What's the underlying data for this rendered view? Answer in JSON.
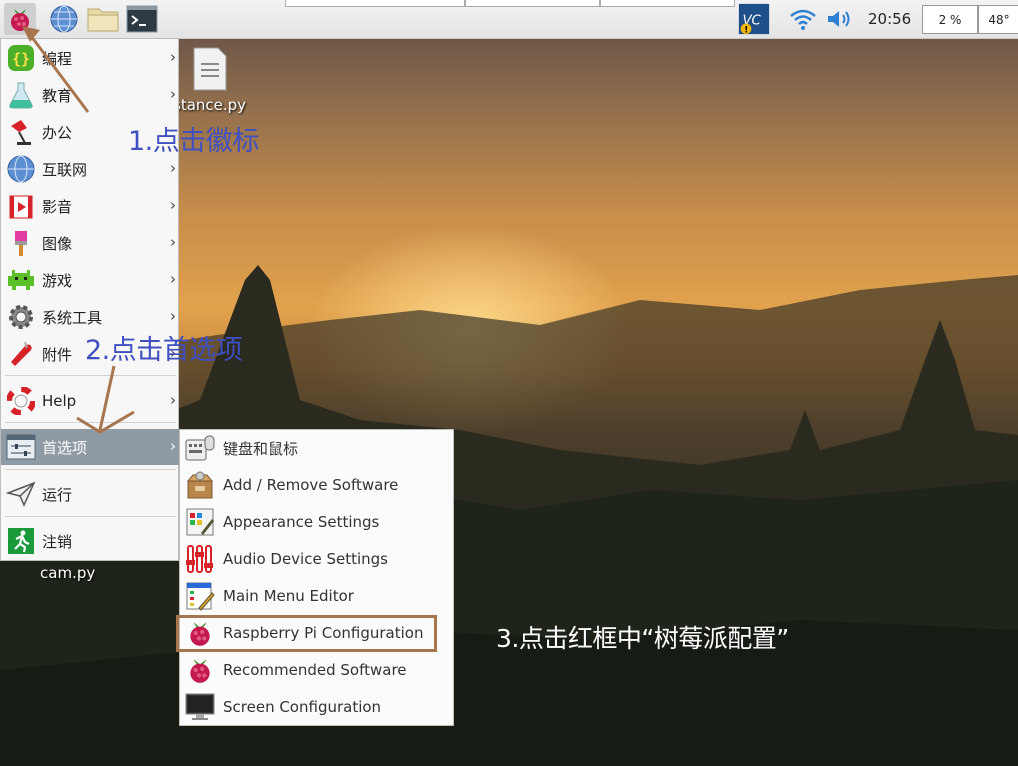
{
  "taskbar": {
    "icons": [
      "raspberry-icon",
      "globe-icon",
      "folder-icon",
      "terminal-icon",
      "vnc-icon",
      "wifi-icon",
      "volume-icon"
    ],
    "clock": "20:56",
    "cpu": "2 %",
    "temp": "48°"
  },
  "desktop": {
    "files": [
      {
        "label": "stance.py"
      },
      {
        "label": "cam.py"
      }
    ]
  },
  "menu": {
    "items": [
      {
        "label": "编程",
        "icon": "programming-icon",
        "submenu": true
      },
      {
        "label": "教育",
        "icon": "education-icon",
        "submenu": true
      },
      {
        "label": "办公",
        "icon": "office-icon",
        "submenu": true
      },
      {
        "label": "互联网",
        "icon": "internet-icon",
        "submenu": true
      },
      {
        "label": "影音",
        "icon": "media-icon",
        "submenu": true
      },
      {
        "label": "图像",
        "icon": "graphics-icon",
        "submenu": true
      },
      {
        "label": "游戏",
        "icon": "games-icon",
        "submenu": true
      },
      {
        "label": "系统工具",
        "icon": "system-tools-icon",
        "submenu": true
      },
      {
        "label": "附件",
        "icon": "accessories-icon",
        "submenu": true
      },
      {
        "label": "Help",
        "icon": "help-icon",
        "submenu": true
      },
      {
        "label": "首选项",
        "icon": "preferences-icon",
        "submenu": true,
        "selected": true
      },
      {
        "label": "运行",
        "icon": "run-icon",
        "submenu": false
      },
      {
        "label": "注销",
        "icon": "logout-icon",
        "submenu": false
      }
    ],
    "arrow": "›"
  },
  "submenu": {
    "items": [
      {
        "label": "键盘和鼠标",
        "icon": "keyboard-mouse-icon"
      },
      {
        "label": "Add / Remove Software",
        "icon": "package-icon"
      },
      {
        "label": "Appearance Settings",
        "icon": "appearance-icon"
      },
      {
        "label": "Audio Device Settings",
        "icon": "audio-mixer-icon"
      },
      {
        "label": "Main Menu Editor",
        "icon": "menu-editor-icon"
      },
      {
        "label": "Raspberry Pi Configuration",
        "icon": "raspberry-icon",
        "highlighted": true
      },
      {
        "label": "Recommended Software",
        "icon": "raspberry-icon"
      },
      {
        "label": "Screen Configuration",
        "icon": "monitor-icon"
      }
    ]
  },
  "annotations": {
    "step1": "1.点击徽标",
    "step2": "2.点击首选项",
    "step3": "3.点击红框中“树莓派配置”",
    "blue_color": "#3f4fc0",
    "arrow_color": "#a7764f"
  }
}
